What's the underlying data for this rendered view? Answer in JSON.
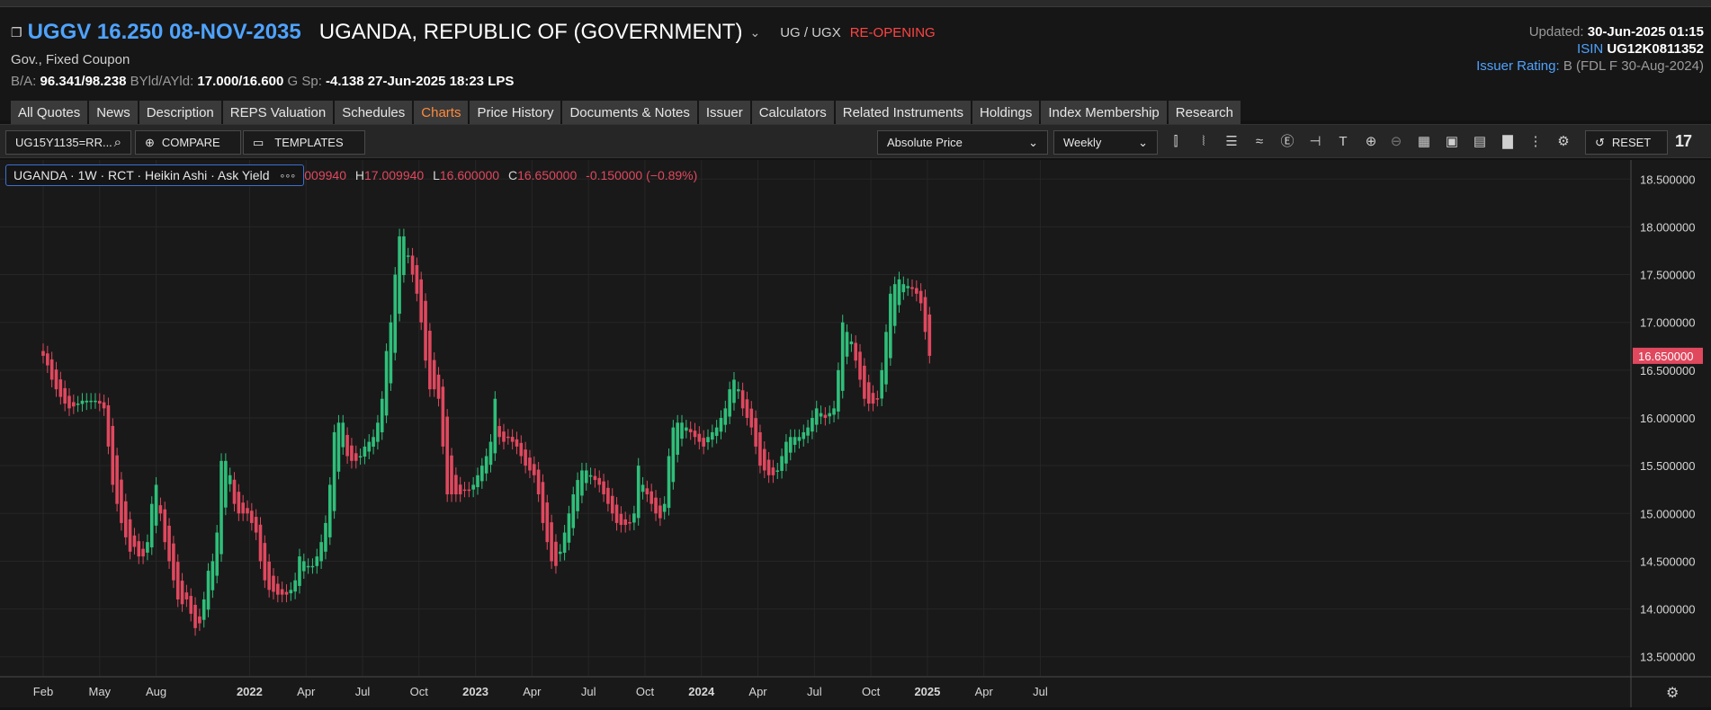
{
  "header": {
    "ticker": "UGGV 16.250 08-NOV-2035",
    "issuer": "UGANDA, REPUBLIC OF (GOVERNMENT)",
    "currency_pair": "UG / UGX",
    "status": "RE-OPENING",
    "subtitle": "Gov., Fixed Coupon",
    "ba_label": "B/A:",
    "ba_value": "96.341/98.238",
    "byld_label": "BYld/AYld:",
    "byld_value": "17.000/16.600",
    "gsp_label": "G Sp:",
    "gsp_value": "-4.138",
    "datetime": "27-Jun-2025 18:23",
    "source": "LPS",
    "updated_label": "Updated:",
    "updated_value": "30-Jun-2025 01:15",
    "isin_label": "ISIN",
    "isin_value": "UG12K0811352",
    "rating_label": "Issuer Rating:",
    "rating_value": "B (FDL F 30-Aug-2024)"
  },
  "tabs": [
    {
      "label": "All Quotes",
      "active": false
    },
    {
      "label": "News",
      "active": false
    },
    {
      "label": "Description",
      "active": false
    },
    {
      "label": "REPS Valuation",
      "active": false
    },
    {
      "label": "Schedules",
      "active": false
    },
    {
      "label": "Charts",
      "active": true
    },
    {
      "label": "Price History",
      "active": false
    },
    {
      "label": "Documents & Notes",
      "active": false
    },
    {
      "label": "Issuer",
      "active": false
    },
    {
      "label": "Calculators",
      "active": false
    },
    {
      "label": "Related Instruments",
      "active": false
    },
    {
      "label": "Holdings",
      "active": false
    },
    {
      "label": "Index Membership",
      "active": false
    },
    {
      "label": "Research",
      "active": false
    }
  ],
  "toolbar": {
    "ric_value": "UG15Y1135=RR...",
    "compare_label": "COMPARE",
    "templates_label": "TEMPLATES",
    "price_select": "Absolute Price",
    "interval_select": "Weekly",
    "reset_label": "RESET",
    "logo_text": "17"
  },
  "legend": {
    "label": "UGANDA · 1W · RCT · Heikin Ashi · Ask Yield",
    "o_value": "009940",
    "h_label": "H",
    "h_value": "17.009940",
    "l_label": "L",
    "l_value": "16.600000",
    "c_label": "C",
    "c_value": "16.650000",
    "change": "-0.150000 (−0.89%)"
  },
  "colors": {
    "up": "#2fbf7a",
    "down": "#e0485e",
    "accent": "#4fa3ff",
    "active_tab": "#ff8a3c"
  },
  "chart_data": {
    "type": "candlestick",
    "ylim": [
      13.3,
      18.7
    ],
    "yticks": [
      "13.500000",
      "14.000000",
      "14.500000",
      "15.000000",
      "15.500000",
      "16.000000",
      "16.500000",
      "17.000000",
      "17.500000",
      "18.000000",
      "18.500000"
    ],
    "xticks": [
      {
        "label": "Feb",
        "bold": false,
        "t": 0.0
      },
      {
        "label": "May",
        "bold": false,
        "t": 13.0
      },
      {
        "label": "Aug",
        "bold": false,
        "t": 26.0
      },
      {
        "label": "2022",
        "bold": true,
        "t": 47.5
      },
      {
        "label": "Apr",
        "bold": false,
        "t": 60.5
      },
      {
        "label": "Jul",
        "bold": false,
        "t": 73.5
      },
      {
        "label": "Oct",
        "bold": false,
        "t": 86.5
      },
      {
        "label": "2023",
        "bold": true,
        "t": 99.5
      },
      {
        "label": "Apr",
        "bold": false,
        "t": 112.5
      },
      {
        "label": "Jul",
        "bold": false,
        "t": 125.5
      },
      {
        "label": "Oct",
        "bold": false,
        "t": 138.5
      },
      {
        "label": "2024",
        "bold": true,
        "t": 151.5
      },
      {
        "label": "Apr",
        "bold": false,
        "t": 164.5
      },
      {
        "label": "Jul",
        "bold": false,
        "t": 177.5
      },
      {
        "label": "Oct",
        "bold": false,
        "t": 190.5
      },
      {
        "label": "2025",
        "bold": true,
        "t": 203.5
      },
      {
        "label": "Apr",
        "bold": false,
        "t": 216.5
      },
      {
        "label": "Jul",
        "bold": false,
        "t": 229.5
      }
    ],
    "last_price_label": "16.650000",
    "last_price": 16.65,
    "closes": [
      16.65,
      16.55,
      16.4,
      16.3,
      16.22,
      16.15,
      16.1,
      16.12,
      16.15,
      16.18,
      16.18,
      16.18,
      16.18,
      16.15,
      16.1,
      15.7,
      15.3,
      15.1,
      14.9,
      14.75,
      14.6,
      14.65,
      14.55,
      14.55,
      14.7,
      15.1,
      15.3,
      15.0,
      14.7,
      14.5,
      14.3,
      14.1,
      14.05,
      14.1,
      13.95,
      13.8,
      13.85,
      14.1,
      14.4,
      14.5,
      14.8,
      15.55,
      15.55,
      15.4,
      15.1,
      15.0,
      15.0,
      15.0,
      14.9,
      14.8,
      14.5,
      14.3,
      14.2,
      14.18,
      14.15,
      14.15,
      14.15,
      14.2,
      14.3,
      14.55,
      14.5,
      14.45,
      14.45,
      14.55,
      14.7,
      14.9,
      15.3,
      15.85,
      15.95,
      15.95,
      15.6,
      15.55,
      15.55,
      15.6,
      15.7,
      15.75,
      15.8,
      15.95,
      16.2,
      16.7,
      17.0,
      17.5,
      17.9,
      17.9,
      17.7,
      17.5,
      17.3,
      17.0,
      16.6,
      16.3,
      16.3,
      16.2,
      15.7,
      15.2,
      15.2,
      15.2,
      15.2,
      15.25,
      15.25,
      15.3,
      15.4,
      15.5,
      15.6,
      15.75,
      16.2,
      15.8,
      15.75,
      15.8,
      15.75,
      15.7,
      15.6,
      15.5,
      15.45,
      15.4,
      15.2,
      14.9,
      14.7,
      14.5,
      14.45,
      14.6,
      14.8,
      15.0,
      15.2,
      15.35,
      15.45,
      15.45,
      15.4,
      15.35,
      15.3,
      15.2,
      15.1,
      15.0,
      14.9,
      14.88,
      14.88,
      14.9,
      15.0,
      15.5,
      15.3,
      15.2,
      15.1,
      15.0,
      14.95,
      15.1,
      15.6,
      15.9,
      15.95,
      15.95,
      15.9,
      15.85,
      15.8,
      15.75,
      15.7,
      15.8,
      15.85,
      15.9,
      16.0,
      16.1,
      16.3,
      16.4,
      16.3,
      16.1,
      16.0,
      15.9,
      15.7,
      15.5,
      15.45,
      15.4,
      15.4,
      15.45,
      15.6,
      15.75,
      15.8,
      15.8,
      15.8,
      15.85,
      15.9,
      16.0,
      16.1,
      16.05,
      16.0,
      16.05,
      16.1,
      16.5,
      17.0,
      16.9,
      16.8,
      16.6,
      16.4,
      16.2,
      16.15,
      16.15,
      16.2,
      16.5,
      16.9,
      17.3,
      17.4,
      17.45,
      17.4,
      17.38,
      17.35,
      17.3,
      17.2,
      16.9,
      16.65
    ]
  }
}
